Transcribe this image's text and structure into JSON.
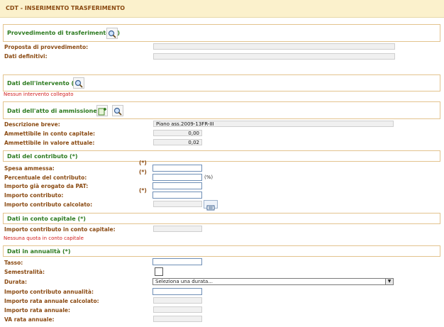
{
  "window": {
    "title": "CDT - INSERIMENTO TRASFERIMENTO"
  },
  "provvedimento": {
    "title": "Provvedimento di trasferimento (*)",
    "proposta_label": "Proposta di provvedimento:",
    "proposta_value": "",
    "definitivi_label": "Dati definitivi:",
    "definitivi_value": ""
  },
  "intervento": {
    "title": "Dati dell'intervento (*)",
    "warning": "Nessun intervento collegato"
  },
  "atto": {
    "title": "Dati dell'atto di ammissione (*)",
    "descrizione_label": "Descrizione breve:",
    "descrizione_value": "Piano ass.2009-13FR-III",
    "conto_capitale_label": "Ammettibile in conto capitale:",
    "conto_capitale_value": "0,00",
    "valore_attuale_label": "Ammettibile in valore attuale:",
    "valore_attuale_value": "0,02"
  },
  "contributo": {
    "title": "Dati del contributo (*)",
    "req_marker": "(*)",
    "spesa_label": "Spesa ammessa:",
    "spesa_value": "",
    "percentuale_label": "Percentuale del contributo:",
    "percentuale_value": "",
    "percentuale_unit": "(%)",
    "erogato_label": "Importo già erogato da PAT:",
    "erogato_value": "",
    "importo_label": "Importo contributo:",
    "importo_value": "",
    "calcolato_label": "Importo contributo calcolato:",
    "calcolato_value": ""
  },
  "conto_capitale": {
    "title": "Dati in conto capitale (*)",
    "importo_label": "Importo contributo in conto capitale:",
    "importo_value": "",
    "warning": "Nessuna quota in conto capitale"
  },
  "annualita": {
    "title": "Dati in annualità (*)",
    "tasso_label": "Tasso:",
    "tasso_value": "",
    "semestralita_label": "Semestralità:",
    "durata_label": "Durata:",
    "durata_selected": "Seleziona una durata...",
    "importo_annualita_label": "Importo contributo annualità:",
    "importo_annualita_value": "",
    "rata_calcolato_label": "Importo rata annuale calcolato:",
    "rata_calcolato_value": "",
    "rata_annuale_label": "Importo rata annuale:",
    "rata_annuale_value": "",
    "va_rata_label": "VA rata annuale:",
    "va_rata_value": ""
  },
  "colors": {
    "accent_green": "#2c7a1f",
    "label_brown": "#8a4a12",
    "warning_red": "#d11a1a",
    "header_bg": "#fbf1cc"
  },
  "icons": [
    "search-icon",
    "add-icon",
    "calculator-icon",
    "chevron-down-icon"
  ]
}
